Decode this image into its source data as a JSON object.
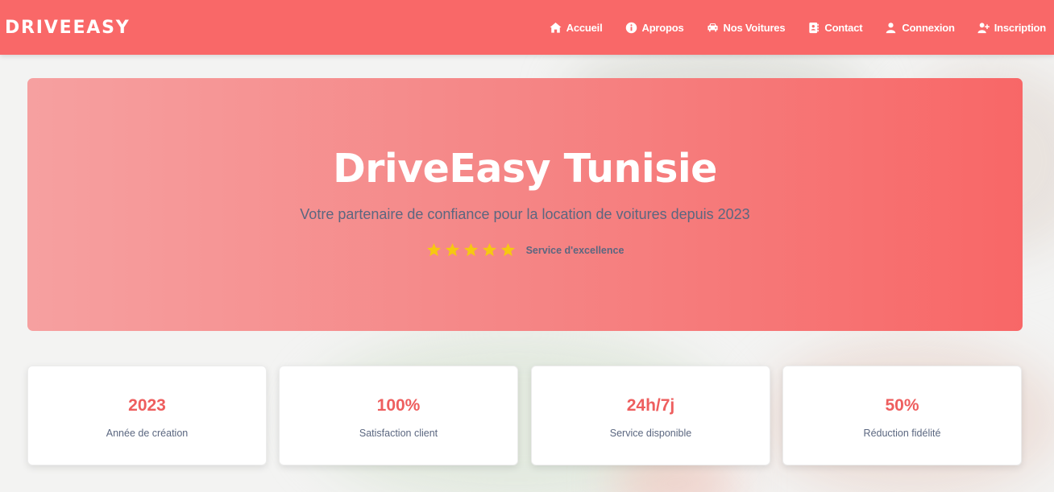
{
  "navbar": {
    "brand": "DRIVEEASY",
    "items": [
      {
        "label": "Accueil",
        "icon": "home-icon"
      },
      {
        "label": "Apropos",
        "icon": "info-icon"
      },
      {
        "label": "Nos Voitures",
        "icon": "car-icon"
      },
      {
        "label": "Contact",
        "icon": "address-book-icon"
      },
      {
        "label": "Connexion",
        "icon": "user-icon"
      },
      {
        "label": "Inscription",
        "icon": "user-plus-icon"
      }
    ]
  },
  "hero": {
    "title": "DriveEasy Tunisie",
    "subtitle": "Votre partenaire de confiance pour la location de voitures depuis 2023",
    "rating": {
      "stars": 5,
      "max": 5,
      "label": "Service d'excellence"
    }
  },
  "stats": [
    {
      "value": "2023",
      "label": "Année de création"
    },
    {
      "value": "100%",
      "label": "Satisfaction client"
    },
    {
      "value": "24h/7j",
      "label": "Service disponible"
    },
    {
      "value": "50%",
      "label": "Réduction fidélité"
    }
  ],
  "colors": {
    "primary": "#f96868",
    "hero_gradient_start": "#f6a0a0",
    "stat_value": "#ee5e5e",
    "muted_text": "#5b6780",
    "star": "#f6c811"
  }
}
